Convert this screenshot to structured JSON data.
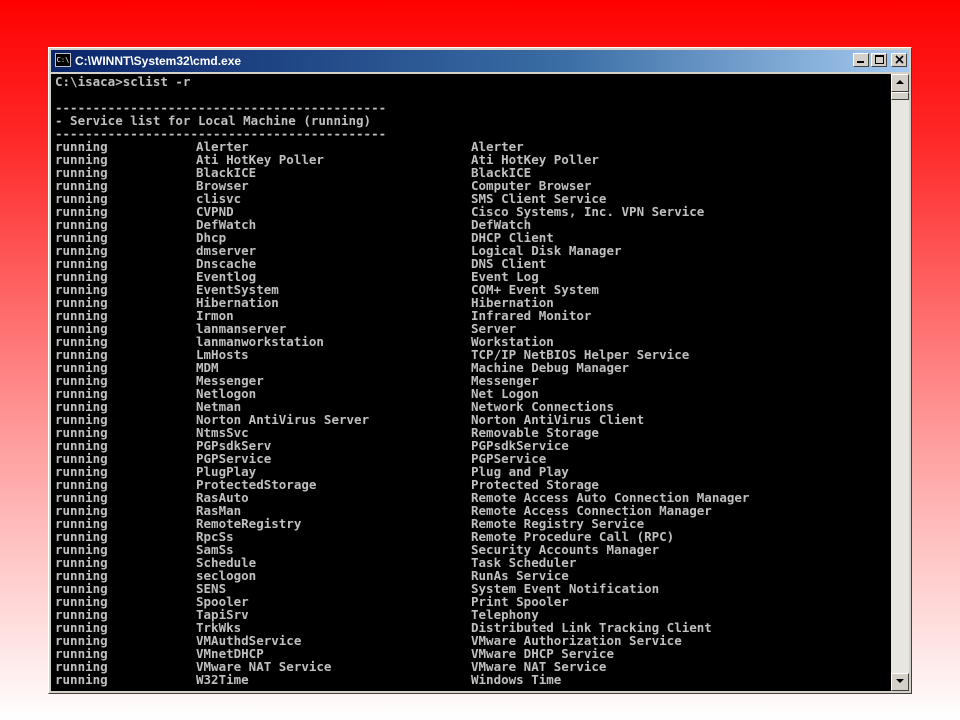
{
  "window": {
    "title": "C:\\WINNT\\System32\\cmd.exe",
    "icon_text": "C:\\",
    "controls": {
      "minimize": "minimize-icon",
      "maximize": "maximize-icon",
      "close": "close-icon"
    }
  },
  "console": {
    "prompt": "C:\\isaca>sclist -r",
    "separator": "--------------------------------------------",
    "header": "- Service list for Local Machine (running)",
    "rows": [
      {
        "status": "running",
        "name": "Alerter",
        "display": "Alerter"
      },
      {
        "status": "running",
        "name": "Ati HotKey Poller",
        "display": "Ati HotKey Poller"
      },
      {
        "status": "running",
        "name": "BlackICE",
        "display": "BlackICE"
      },
      {
        "status": "running",
        "name": "Browser",
        "display": "Computer Browser"
      },
      {
        "status": "running",
        "name": "clisvc",
        "display": "SMS Client Service"
      },
      {
        "status": "running",
        "name": "CVPND",
        "display": "Cisco Systems, Inc. VPN Service"
      },
      {
        "status": "running",
        "name": "DefWatch",
        "display": "DefWatch"
      },
      {
        "status": "running",
        "name": "Dhcp",
        "display": "DHCP Client"
      },
      {
        "status": "running",
        "name": "dmserver",
        "display": "Logical Disk Manager"
      },
      {
        "status": "running",
        "name": "Dnscache",
        "display": "DNS Client"
      },
      {
        "status": "running",
        "name": "Eventlog",
        "display": "Event Log"
      },
      {
        "status": "running",
        "name": "EventSystem",
        "display": "COM+ Event System"
      },
      {
        "status": "running",
        "name": "Hibernation",
        "display": "Hibernation"
      },
      {
        "status": "running",
        "name": "Irmon",
        "display": "Infrared Monitor"
      },
      {
        "status": "running",
        "name": "lanmanserver",
        "display": "Server"
      },
      {
        "status": "running",
        "name": "lanmanworkstation",
        "display": "Workstation"
      },
      {
        "status": "running",
        "name": "LmHosts",
        "display": "TCP/IP NetBIOS Helper Service"
      },
      {
        "status": "running",
        "name": "MDM",
        "display": "Machine Debug Manager"
      },
      {
        "status": "running",
        "name": "Messenger",
        "display": "Messenger"
      },
      {
        "status": "running",
        "name": "Netlogon",
        "display": "Net Logon"
      },
      {
        "status": "running",
        "name": "Netman",
        "display": "Network Connections"
      },
      {
        "status": "running",
        "name": "Norton AntiVirus Server",
        "display": "Norton AntiVirus Client"
      },
      {
        "status": "running",
        "name": "NtmsSvc",
        "display": "Removable Storage"
      },
      {
        "status": "running",
        "name": "PGPsdkServ",
        "display": "PGPsdkService"
      },
      {
        "status": "running",
        "name": "PGPService",
        "display": "PGPService"
      },
      {
        "status": "running",
        "name": "PlugPlay",
        "display": "Plug and Play"
      },
      {
        "status": "running",
        "name": "ProtectedStorage",
        "display": "Protected Storage"
      },
      {
        "status": "running",
        "name": "RasAuto",
        "display": "Remote Access Auto Connection Manager"
      },
      {
        "status": "running",
        "name": "RasMan",
        "display": "Remote Access Connection Manager"
      },
      {
        "status": "running",
        "name": "RemoteRegistry",
        "display": "Remote Registry Service"
      },
      {
        "status": "running",
        "name": "RpcSs",
        "display": "Remote Procedure Call (RPC)"
      },
      {
        "status": "running",
        "name": "SamSs",
        "display": "Security Accounts Manager"
      },
      {
        "status": "running",
        "name": "Schedule",
        "display": "Task Scheduler"
      },
      {
        "status": "running",
        "name": "seclogon",
        "display": "RunAs Service"
      },
      {
        "status": "running",
        "name": "SENS",
        "display": "System Event Notification"
      },
      {
        "status": "running",
        "name": "Spooler",
        "display": "Print Spooler"
      },
      {
        "status": "running",
        "name": "TapiSrv",
        "display": "Telephony"
      },
      {
        "status": "running",
        "name": "TrkWks",
        "display": "Distributed Link Tracking Client"
      },
      {
        "status": "running",
        "name": "VMAuthdService",
        "display": "VMware Authorization Service"
      },
      {
        "status": "running",
        "name": "VMnetDHCP",
        "display": "VMware DHCP Service"
      },
      {
        "status": "running",
        "name": "VMware NAT Service",
        "display": "VMware NAT Service"
      },
      {
        "status": "running",
        "name": "W32Time",
        "display": "Windows Time"
      }
    ]
  },
  "colors": {
    "background_top": "#ff0000",
    "background_bottom": "#ffffff",
    "titlebar": "#0a246a",
    "console_bg": "#000000",
    "console_text": "#c0c0c0"
  }
}
